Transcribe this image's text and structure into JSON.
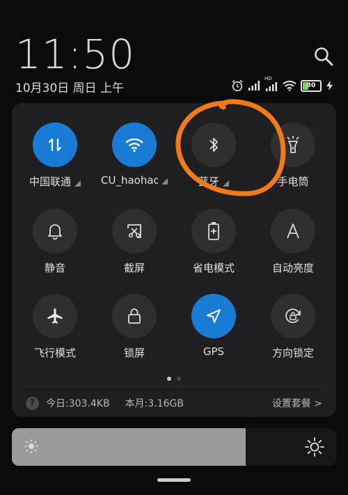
{
  "clock": {
    "time": "11:50",
    "date": "10月30日 周日 上午"
  },
  "status_bar": {
    "battery": "30",
    "network_badge": "HD",
    "icons": [
      "alarm-icon",
      "signal-icon",
      "hd-signal-icon",
      "wifi-icon",
      "battery-icon",
      "charging-icon"
    ]
  },
  "tiles": [
    {
      "label": "中国联通",
      "icon": "mobile-data-icon",
      "active": true,
      "expandable": true
    },
    {
      "label": "CU_haohao",
      "icon": "wifi-icon",
      "active": true,
      "expandable": true
    },
    {
      "label": "蓝牙",
      "icon": "bluetooth-icon",
      "active": false,
      "expandable": true
    },
    {
      "label": "手电筒",
      "icon": "flashlight-icon",
      "active": false,
      "expandable": false
    },
    {
      "label": "静音",
      "icon": "bell-icon",
      "active": false,
      "expandable": false
    },
    {
      "label": "截屏",
      "icon": "screenshot-icon",
      "active": false,
      "expandable": false
    },
    {
      "label": "省电模式",
      "icon": "battery-saver-icon",
      "active": false,
      "expandable": false
    },
    {
      "label": "自动亮度",
      "icon": "auto-brightness-icon",
      "active": false,
      "expandable": false
    },
    {
      "label": "飞行模式",
      "icon": "airplane-icon",
      "active": false,
      "expandable": false
    },
    {
      "label": "锁屏",
      "icon": "lock-icon",
      "active": false,
      "expandable": false
    },
    {
      "label": "GPS",
      "icon": "location-icon",
      "active": true,
      "expandable": false
    },
    {
      "label": "方向锁定",
      "icon": "rotation-lock-icon",
      "active": false,
      "expandable": false
    }
  ],
  "pager": {
    "pages": 2,
    "current": 1
  },
  "data_usage": {
    "help": "?",
    "today": "今日:303.4KB",
    "month": "本月:3.16GB",
    "settings": "设置套餐 >"
  },
  "brightness": {
    "level_fraction": 0.72
  },
  "colors": {
    "active": "#1a7bd4",
    "annotation": "#f27a1a"
  }
}
